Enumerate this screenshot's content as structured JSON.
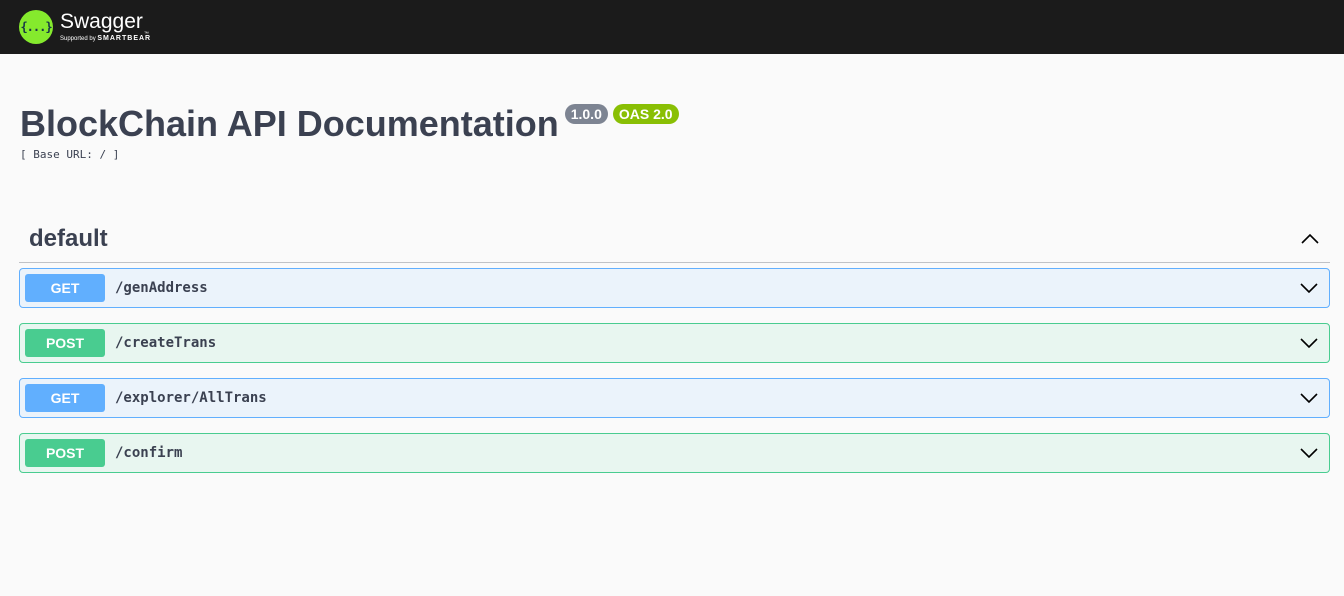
{
  "topbar": {
    "logo_symbol": "{...}",
    "logo_name": "Swagger",
    "logo_tm": "™",
    "logo_sub_prefix": "Supported by",
    "logo_sub_brand": "SMARTBEAR",
    "logo_color": "#85ea2d"
  },
  "info": {
    "title": "BlockChain API Documentation",
    "version": "1.0.0",
    "oas": "OAS 2.0",
    "base_url": "[ Base URL: / ]"
  },
  "section": {
    "tag": "default",
    "expanded": true,
    "operations": [
      {
        "method": "GET",
        "path": "/genAddress"
      },
      {
        "method": "POST",
        "path": "/createTrans"
      },
      {
        "method": "GET",
        "path": "/explorer/AllTrans"
      },
      {
        "method": "POST",
        "path": "/confirm"
      }
    ]
  },
  "colors": {
    "get": "#61affe",
    "post": "#49cc90",
    "version_badge": "#7d8492",
    "oas_badge": "#89bf04"
  }
}
